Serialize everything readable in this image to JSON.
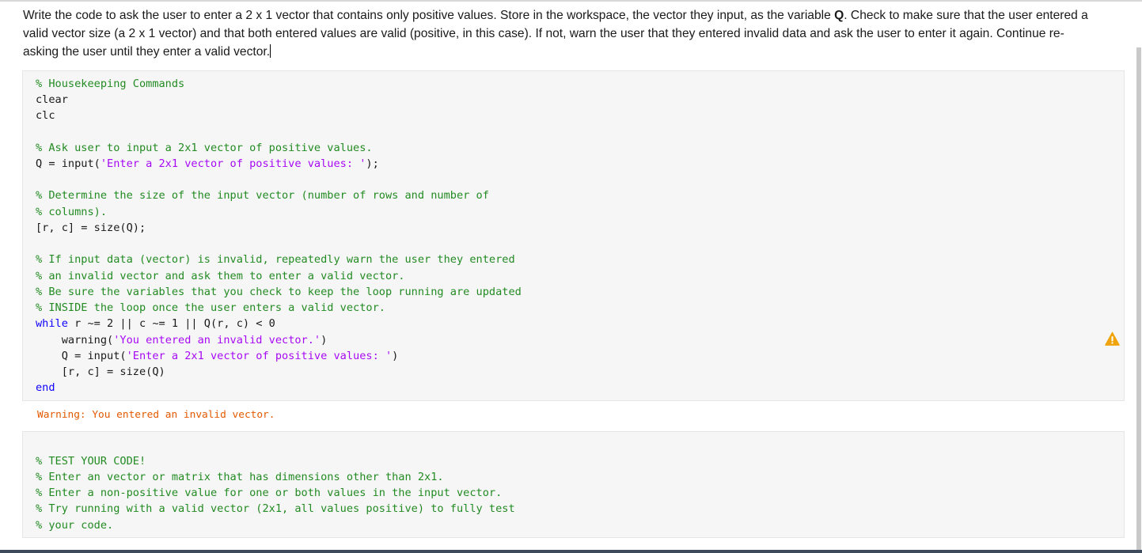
{
  "problem": {
    "line1_before_q": "Write the code to ask the user to enter a 2 x 1 vector that contains only positive values. Store in the workspace, the vector they input, as the variable ",
    "variable_name": "Q",
    "line1_after_q": ". Check to make sure that the user entered a",
    "line2": "valid vector size (a  2 x 1 vector) and that both entered values are valid (positive, in this case).  If not, warn the user that they entered invalid data and ask the user to enter it again. Continue re-",
    "line3": "asking the user until they enter a valid vector."
  },
  "code_block_1": {
    "l01": "% Housekeeping Commands",
    "l02": "clear",
    "l03": "clc",
    "l05": "% Ask user to input a 2x1 vector of positive values.",
    "l06_a": "Q = input(",
    "l06_str": "'Enter a 2x1 vector of positive values: '",
    "l06_b": ");",
    "l08": "% Determine the size of the input vector (number of rows and number of",
    "l09": "% columns).",
    "l10": "[r, c] = size(Q);",
    "l12": "% If input data (vector) is invalid, repeatedly warn the user they entered",
    "l13": "% an invalid vector and ask them to enter a valid vector.",
    "l14": "% Be sure the variables that you check to keep the loop running are updated",
    "l15": "% INSIDE the loop once the user enters a valid vector.",
    "l16_kw": "while",
    "l16_rest": " r ~= 2 || c ~= 1 || Q(r, c) < 0",
    "l17_a": "    warning(",
    "l17_str": "'You entered an invalid vector.'",
    "l17_b": ")",
    "l18_a": "    Q = input(",
    "l18_str": "'Enter a 2x1 vector of positive values: '",
    "l18_b": ")",
    "l19": "    [r, c] = size(Q)",
    "l20_kw": "end"
  },
  "output": {
    "warning_text": "Warning: You entered an invalid vector."
  },
  "code_block_2": {
    "l01": "% TEST YOUR CODE!",
    "l02": "% Enter an vector or matrix that has dimensions other than 2x1.",
    "l03": "% Enter a non-positive value for one or both values in the input vector.",
    "l04": "% Try running with a valid vector (2x1, all values positive) to fully test",
    "l05": "% your code."
  },
  "colors": {
    "comment": "#228b22",
    "string": "#a709f5",
    "keyword": "#0e00ff",
    "warning": "#e35900",
    "warning_icon": "#f0a30a"
  },
  "icons": {
    "warning_indicator": "warning-triangle-icon"
  }
}
